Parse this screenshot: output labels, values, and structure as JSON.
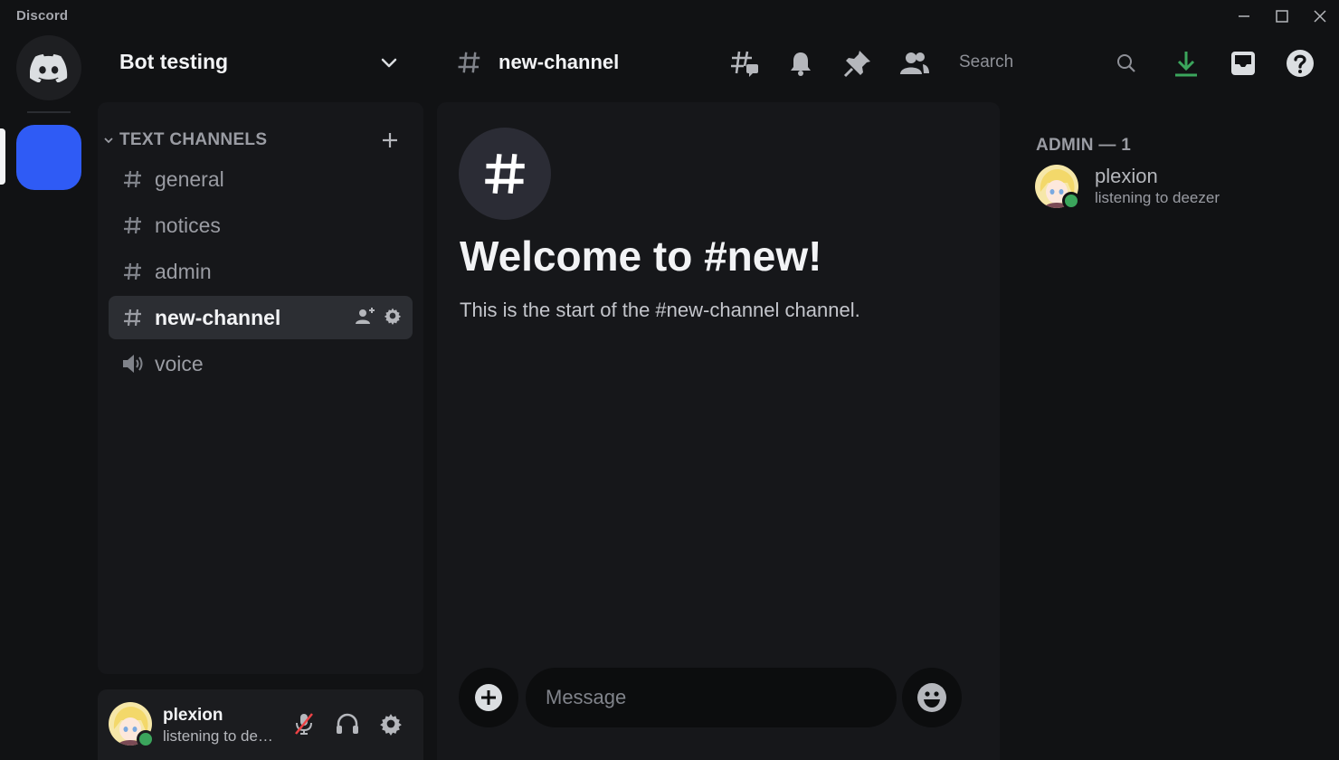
{
  "app": {
    "brand": "Discord"
  },
  "server": {
    "name": "Bot testing"
  },
  "channels": {
    "category": "TEXT CHANNELS",
    "items": [
      {
        "name": "general",
        "type": "text",
        "active": false
      },
      {
        "name": "notices",
        "type": "text",
        "active": false
      },
      {
        "name": "admin",
        "type": "text",
        "active": false
      },
      {
        "name": "new-channel",
        "type": "text",
        "active": true
      },
      {
        "name": "voice",
        "type": "voice",
        "active": false
      }
    ]
  },
  "header": {
    "channel": "new-channel",
    "search_placeholder": "Search",
    "icons": [
      "threads-icon",
      "bell-icon",
      "pin-icon",
      "members-icon",
      "search-icon",
      "download-icon",
      "inbox-icon",
      "help-icon"
    ]
  },
  "chat": {
    "welcome_title": "Welcome to #new!",
    "welcome_sub": "This is the start of the #new-channel channel.",
    "composer_placeholder": "Message"
  },
  "members": {
    "heading": "ADMIN — 1",
    "list": [
      {
        "name": "plexion",
        "status": "listening to deezer"
      }
    ]
  },
  "user": {
    "name": "plexion",
    "status": "listening to deezer"
  },
  "colors": {
    "accent": "#2f5bf5",
    "online": "#3ba55c",
    "download": "#3ba55c",
    "mute_slash": "#ed4245"
  }
}
